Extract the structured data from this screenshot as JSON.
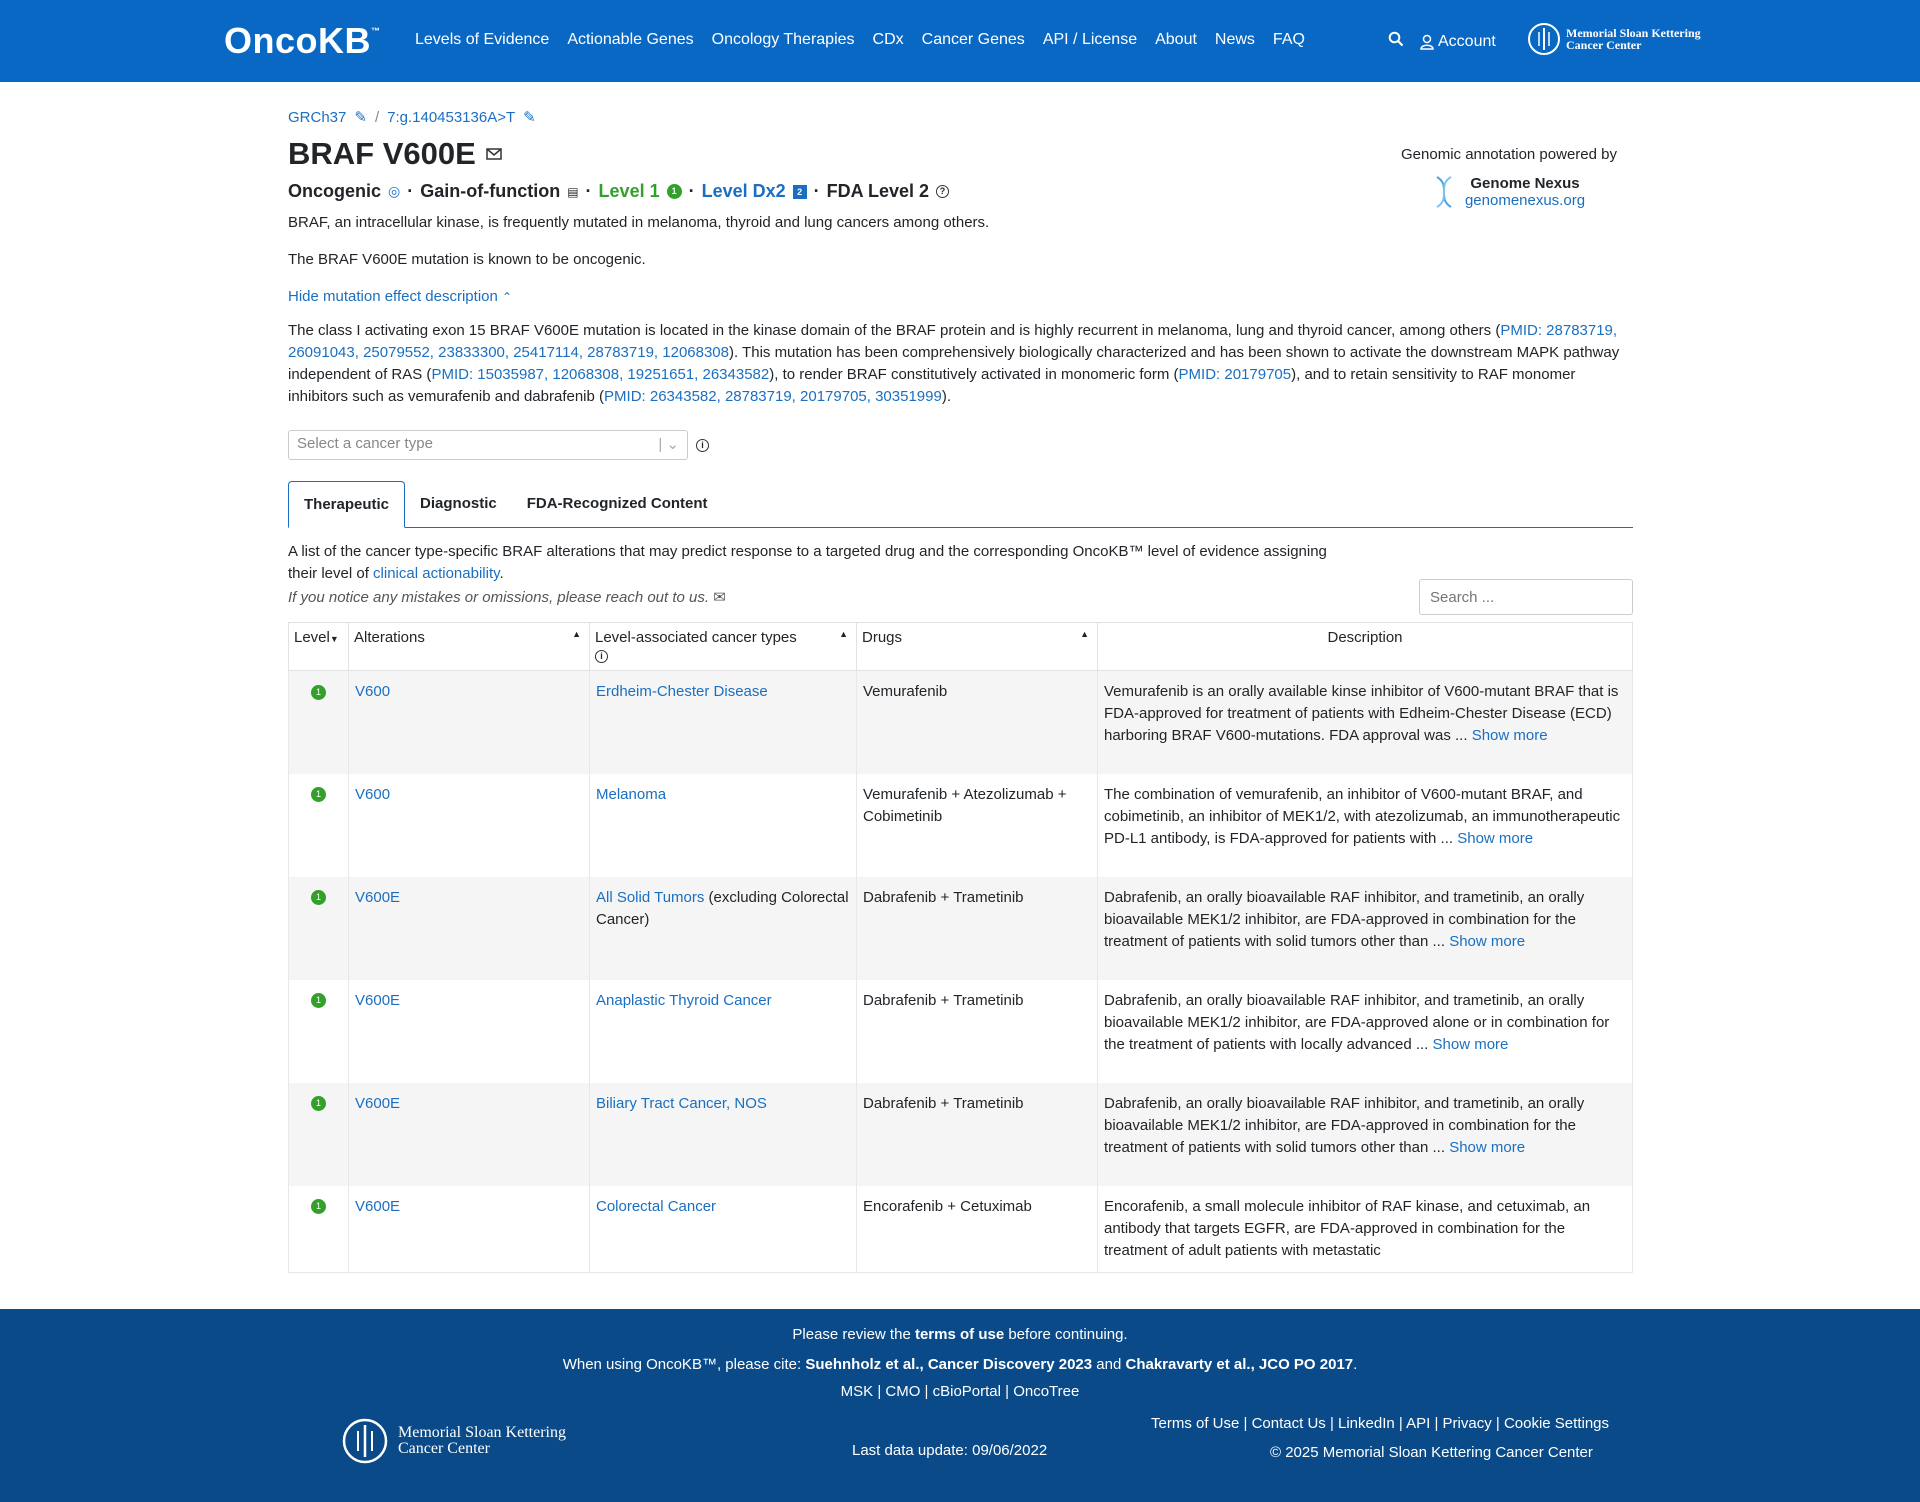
{
  "header": {
    "brand": "OncoKB",
    "brand_tm": "™",
    "nav": [
      "Levels of Evidence",
      "Actionable Genes",
      "Oncology Therapies",
      "CDx",
      "Cancer Genes",
      "API / License",
      "About",
      "News",
      "FAQ"
    ],
    "account": "Account",
    "msk_line1": "Memorial Sloan Kettering",
    "msk_line2": "Cancer Center"
  },
  "breadcrumbs": {
    "genome": "GRCh37",
    "variant": "7:g.140453136A>T"
  },
  "page": {
    "title": "BRAF V600E",
    "oncogenic": "Oncogenic",
    "effect": "Gain-of-function",
    "level": "Level 1",
    "level_dx": "Level Dx2",
    "fda_level": "FDA Level 2",
    "summary1": "BRAF, an intracellular kinase, is frequently mutated in melanoma, thyroid and lung cancers among others.",
    "summary2": "The BRAF V600E mutation is known to be oncogenic.",
    "hide_link": "Hide mutation effect description",
    "desc_a": "The class I activating exon 15 BRAF V600E mutation is located in the kinase domain of the BRAF protein and is highly recurrent in melanoma, lung and thyroid cancer, among others (",
    "pmid1": "PMID: 28783719, 26091043, 25079552, 23833300, 25417114, 28783719, 12068308",
    "desc_b": "). This mutation has been comprehensively biologically characterized and has been shown to activate the downstream MAPK pathway independent of RAS (",
    "pmid2": "PMID: 15035987, 12068308, 19251651, 26343582",
    "desc_c": "), to render BRAF constitutively activated in monomeric form (",
    "pmid3": "PMID: 20179705",
    "desc_d": "), and to retain sensitivity to RAF monomer inhibitors such as vemurafenib and dabrafenib (",
    "pmid4": "PMID: 26343582, 28783719, 20179705, 30351999",
    "desc_e": ").",
    "select_placeholder": "Select a cancer type"
  },
  "genomic": {
    "label": "Genomic annotation powered by",
    "name": "Genome Nexus",
    "url": "genomenexus.org"
  },
  "tabs": [
    "Therapeutic",
    "Diagnostic",
    "FDA-Recognized Content"
  ],
  "therapeutic": {
    "intro_a": "A list of the cancer type-specific BRAF alterations that may predict response to a targeted drug and the corresponding OncoKB™ level of evidence assigning their level of ",
    "intro_link": "clinical actionability",
    "intro_b": ".",
    "notice": "If you notice any mistakes or omissions, please reach out to us.",
    "search_placeholder": "Search ..."
  },
  "table": {
    "headers": [
      "Level",
      "Alterations",
      "Level-associated cancer types",
      "Drugs",
      "Description"
    ],
    "show_more": "Show more",
    "rows": [
      {
        "level": "1",
        "alteration": "V600",
        "cancer": "Erdheim-Chester Disease",
        "cancer_extra": "",
        "drugs": "Vemurafenib",
        "desc": "Vemurafenib is an orally available kinse inhibitor of V600-mutant BRAF that is FDA-approved for treatment of patients with Edheim-Chester Disease (ECD) harboring BRAF V600-mutations. FDA approval was  ..."
      },
      {
        "level": "1",
        "alteration": "V600",
        "cancer": "Melanoma",
        "cancer_extra": "",
        "drugs": "Vemurafenib + Atezolizumab + Cobimetinib",
        "desc": "The combination of vemurafenib, an inhibitor of V600-mutant BRAF, and cobimetinib, an inhibitor of MEK1/2, with atezolizumab, an immunotherapeutic PD-L1 antibody, is FDA-approved for patients with  ..."
      },
      {
        "level": "1",
        "alteration": "V600E",
        "cancer": "All Solid Tumors",
        "cancer_extra": " (excluding Colorectal Cancer)",
        "drugs": "Dabrafenib + Trametinib",
        "desc": "Dabrafenib, an orally bioavailable RAF inhibitor, and trametinib, an orally bioavailable MEK1/2 inhibitor, are FDA-approved in combination for the treatment of patients with solid tumors other than  ..."
      },
      {
        "level": "1",
        "alteration": "V600E",
        "cancer": "Anaplastic Thyroid Cancer",
        "cancer_extra": "",
        "drugs": "Dabrafenib + Trametinib",
        "desc": "Dabrafenib, an orally bioavailable RAF inhibitor, and trametinib, an orally bioavailable MEK1/2 inhibitor, are FDA-approved alone or in combination for the treatment of patients with locally advanced  ..."
      },
      {
        "level": "1",
        "alteration": "V600E",
        "cancer": "Biliary Tract Cancer, NOS",
        "cancer_extra": "",
        "drugs": "Dabrafenib + Trametinib",
        "desc": "Dabrafenib, an orally bioavailable RAF inhibitor, and trametinib, an orally bioavailable MEK1/2 inhibitor, are FDA-approved in combination for the treatment of patients with solid tumors other than  ..."
      },
      {
        "level": "1",
        "alteration": "V600E",
        "cancer": "Colorectal Cancer",
        "cancer_extra": "",
        "drugs": "Encorafenib + Cetuximab",
        "desc": "Encorafenib, a small molecule inhibitor of RAF kinase, and cetuximab, an antibody that targets EGFR, are FDA-approved in combination for the treatment of adult patients with metastatic"
      }
    ]
  },
  "footer": {
    "review_a": "Please review the ",
    "review_b": "terms of use",
    "review_c": " before continuing.",
    "cite_a": "When using OncoKB™, please cite: ",
    "cite_b": "Suehnholz et al., Cancer Discovery 2023",
    "cite_c": " and ",
    "cite_d": "Chakravarty et al., JCO PO 2017",
    "cite_e": ".",
    "links": "MSK | CMO | cBioPortal | OncoTree",
    "last_update": "Last data update: 09/06/2022",
    "right_links": "Terms of Use | Contact Us | LinkedIn | API | Privacy | Cookie Settings",
    "copyright": "© 2025 Memorial Sloan Kettering Cancer Center",
    "msk_line1": "Memorial Sloan Kettering",
    "msk_line2": "Cancer Center"
  },
  "colors": {
    "header_bg": "#0968c3",
    "footer_bg": "#0a4a88",
    "link": "#1a6fc1",
    "level1": "#33a02c"
  }
}
